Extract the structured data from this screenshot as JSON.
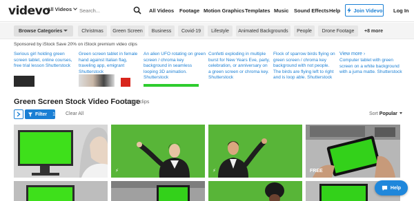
{
  "header": {
    "logo": "videvo",
    "search_category": "All Videos",
    "search_placeholder": "Search...",
    "nav": [
      "All Videos",
      "Footage",
      "Motion Graphics",
      "Templates",
      "Music",
      "Sound Effects",
      "Help"
    ],
    "join_label": "Join Videvo",
    "login_label": "Log In"
  },
  "categories": {
    "browse_label": "Browse Categories",
    "chips": [
      "Christmas",
      "Green Screen",
      "Business",
      "Covid-19",
      "Lifestyle",
      "Animated Backgrounds",
      "People",
      "Drone Footage"
    ],
    "more_label": "+8 more"
  },
  "sponsored": {
    "text": "Sponsored by iStock  Save 20% on iStock premium video clips",
    "cards": [
      "Serious girl holding green screen tablet, online courses, free trial lesson Shutterstock",
      "Green screen tablet in female hand against Italian flag, traveling app, emigrant Shutterstock",
      "An alien UFO rotating on green screen / chroma key background in seamless looping 3D animation. Shutterstock",
      "Confetti exploding in multiple burst for New Years Eve, party, celebration, or anniversary on a green screen or chroma key. Shutterstock",
      "Flock of sparrow birds flying on green screen / chroma key background with not people. The birds are flying left to right and is loop able. Shutterstock"
    ],
    "view_more": "View more ›",
    "last_card": "Computer tablet with green screen on a white background with a juma matte. Shutterstock"
  },
  "section": {
    "title": "Green Screen Stock Video Footage",
    "count": "33,603 clips"
  },
  "filters": {
    "filter_label": "Filter",
    "filter_count": "1",
    "clear_all": "Clear All",
    "sort_label": "Sort",
    "sort_value": "Popular"
  },
  "tiles": [
    {
      "badge": ""
    },
    {
      "badge": "⚡"
    },
    {
      "badge": "⚡"
    },
    {
      "badge": "FREE"
    }
  ],
  "help_label": "Help",
  "colors": {
    "accent": "#1a7fd4",
    "green_screen": "#4fae3d"
  }
}
